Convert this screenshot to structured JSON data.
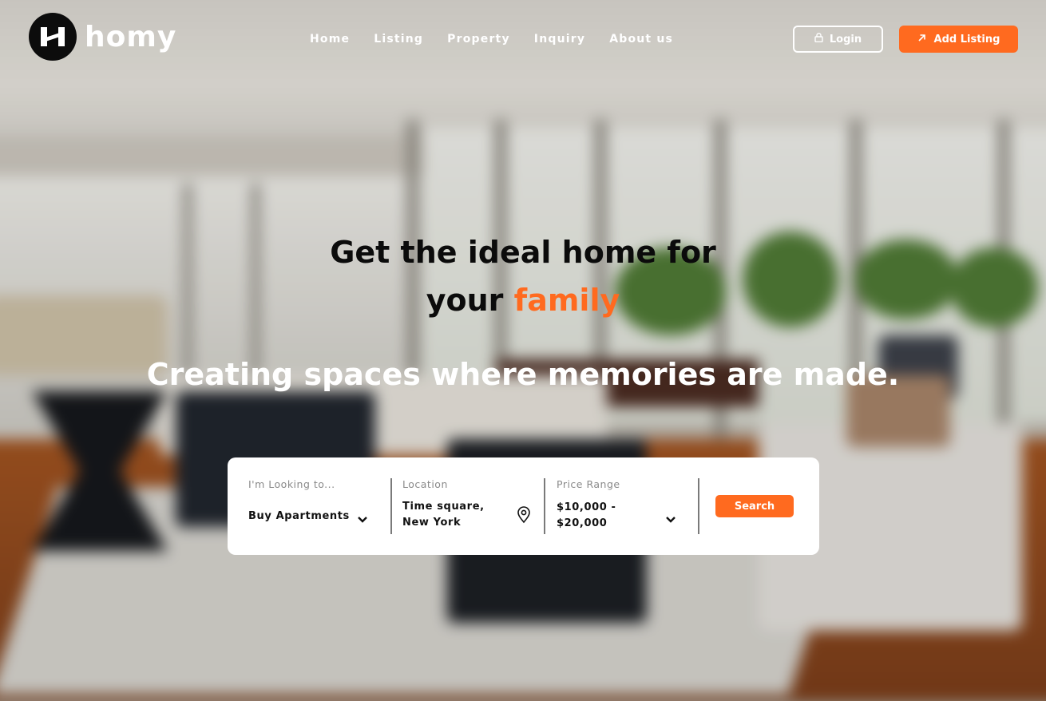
{
  "brand": {
    "name": "homy",
    "accent_color": "#ff6a1f"
  },
  "nav": {
    "items": [
      {
        "label": "Home"
      },
      {
        "label": "Listing"
      },
      {
        "label": "Property"
      },
      {
        "label": "Inquiry"
      },
      {
        "label": "About us"
      }
    ]
  },
  "header_actions": {
    "login_label": "Login",
    "login_icon": "lock-icon",
    "add_listing_label": "Add Listing",
    "add_listing_icon": "arrow-up-right-icon"
  },
  "hero": {
    "title_line1": "Get the ideal home for",
    "title_line2_prefix": "your",
    "title_line2_accent": "family",
    "subtitle": "Creating spaces where memories are made."
  },
  "search": {
    "looking_to": {
      "label": "I'm Looking to...",
      "value": "Buy Apartments",
      "icon": "chevron-down-icon"
    },
    "location": {
      "label": "Location",
      "value_line1": "Time square,",
      "value_line2": "New York",
      "icon": "map-pin-icon"
    },
    "price_range": {
      "label": "Price Range",
      "value_line1": "$10,000 -",
      "value_line2": "$20,000",
      "icon": "chevron-down-icon"
    },
    "button_label": "Search"
  }
}
